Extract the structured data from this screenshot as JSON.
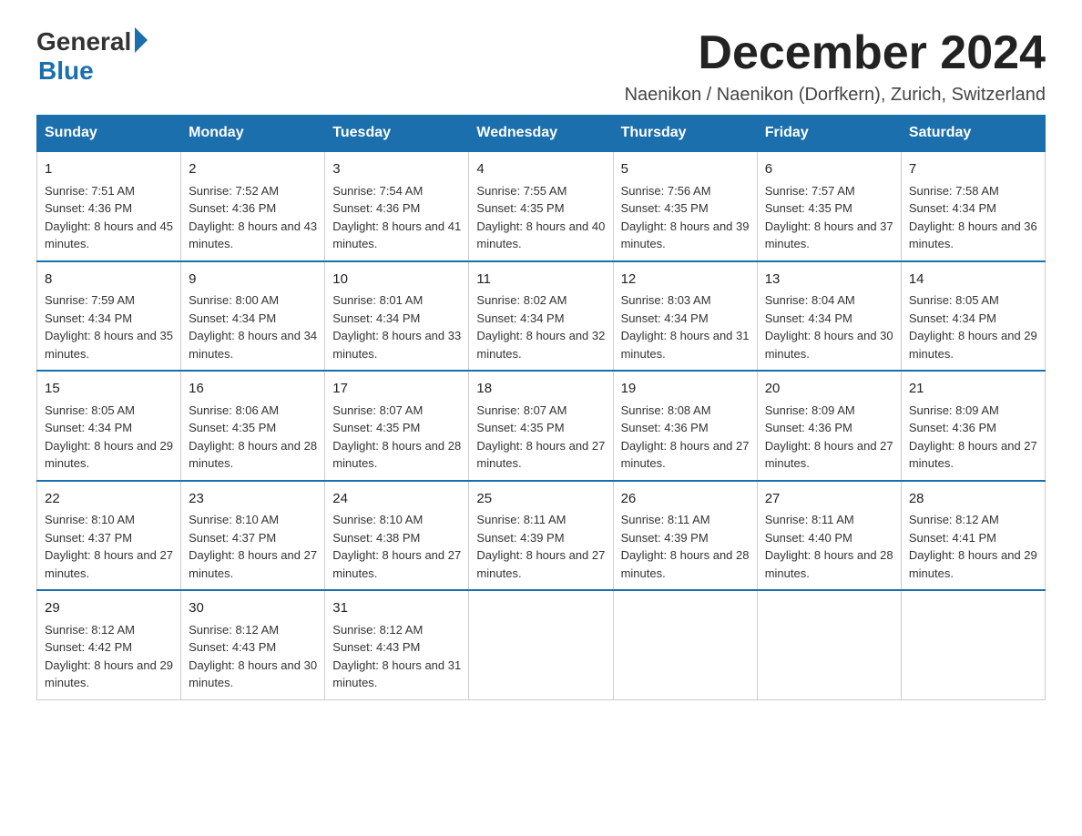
{
  "logo": {
    "general": "General",
    "blue": "Blue"
  },
  "title": "December 2024",
  "subtitle": "Naenikon / Naenikon (Dorfkern), Zurich, Switzerland",
  "days": [
    "Sunday",
    "Monday",
    "Tuesday",
    "Wednesday",
    "Thursday",
    "Friday",
    "Saturday"
  ],
  "weeks": [
    [
      {
        "day": "1",
        "sunrise": "Sunrise: 7:51 AM",
        "sunset": "Sunset: 4:36 PM",
        "daylight": "Daylight: 8 hours and 45 minutes."
      },
      {
        "day": "2",
        "sunrise": "Sunrise: 7:52 AM",
        "sunset": "Sunset: 4:36 PM",
        "daylight": "Daylight: 8 hours and 43 minutes."
      },
      {
        "day": "3",
        "sunrise": "Sunrise: 7:54 AM",
        "sunset": "Sunset: 4:36 PM",
        "daylight": "Daylight: 8 hours and 41 minutes."
      },
      {
        "day": "4",
        "sunrise": "Sunrise: 7:55 AM",
        "sunset": "Sunset: 4:35 PM",
        "daylight": "Daylight: 8 hours and 40 minutes."
      },
      {
        "day": "5",
        "sunrise": "Sunrise: 7:56 AM",
        "sunset": "Sunset: 4:35 PM",
        "daylight": "Daylight: 8 hours and 39 minutes."
      },
      {
        "day": "6",
        "sunrise": "Sunrise: 7:57 AM",
        "sunset": "Sunset: 4:35 PM",
        "daylight": "Daylight: 8 hours and 37 minutes."
      },
      {
        "day": "7",
        "sunrise": "Sunrise: 7:58 AM",
        "sunset": "Sunset: 4:34 PM",
        "daylight": "Daylight: 8 hours and 36 minutes."
      }
    ],
    [
      {
        "day": "8",
        "sunrise": "Sunrise: 7:59 AM",
        "sunset": "Sunset: 4:34 PM",
        "daylight": "Daylight: 8 hours and 35 minutes."
      },
      {
        "day": "9",
        "sunrise": "Sunrise: 8:00 AM",
        "sunset": "Sunset: 4:34 PM",
        "daylight": "Daylight: 8 hours and 34 minutes."
      },
      {
        "day": "10",
        "sunrise": "Sunrise: 8:01 AM",
        "sunset": "Sunset: 4:34 PM",
        "daylight": "Daylight: 8 hours and 33 minutes."
      },
      {
        "day": "11",
        "sunrise": "Sunrise: 8:02 AM",
        "sunset": "Sunset: 4:34 PM",
        "daylight": "Daylight: 8 hours and 32 minutes."
      },
      {
        "day": "12",
        "sunrise": "Sunrise: 8:03 AM",
        "sunset": "Sunset: 4:34 PM",
        "daylight": "Daylight: 8 hours and 31 minutes."
      },
      {
        "day": "13",
        "sunrise": "Sunrise: 8:04 AM",
        "sunset": "Sunset: 4:34 PM",
        "daylight": "Daylight: 8 hours and 30 minutes."
      },
      {
        "day": "14",
        "sunrise": "Sunrise: 8:05 AM",
        "sunset": "Sunset: 4:34 PM",
        "daylight": "Daylight: 8 hours and 29 minutes."
      }
    ],
    [
      {
        "day": "15",
        "sunrise": "Sunrise: 8:05 AM",
        "sunset": "Sunset: 4:34 PM",
        "daylight": "Daylight: 8 hours and 29 minutes."
      },
      {
        "day": "16",
        "sunrise": "Sunrise: 8:06 AM",
        "sunset": "Sunset: 4:35 PM",
        "daylight": "Daylight: 8 hours and 28 minutes."
      },
      {
        "day": "17",
        "sunrise": "Sunrise: 8:07 AM",
        "sunset": "Sunset: 4:35 PM",
        "daylight": "Daylight: 8 hours and 28 minutes."
      },
      {
        "day": "18",
        "sunrise": "Sunrise: 8:07 AM",
        "sunset": "Sunset: 4:35 PM",
        "daylight": "Daylight: 8 hours and 27 minutes."
      },
      {
        "day": "19",
        "sunrise": "Sunrise: 8:08 AM",
        "sunset": "Sunset: 4:36 PM",
        "daylight": "Daylight: 8 hours and 27 minutes."
      },
      {
        "day": "20",
        "sunrise": "Sunrise: 8:09 AM",
        "sunset": "Sunset: 4:36 PM",
        "daylight": "Daylight: 8 hours and 27 minutes."
      },
      {
        "day": "21",
        "sunrise": "Sunrise: 8:09 AM",
        "sunset": "Sunset: 4:36 PM",
        "daylight": "Daylight: 8 hours and 27 minutes."
      }
    ],
    [
      {
        "day": "22",
        "sunrise": "Sunrise: 8:10 AM",
        "sunset": "Sunset: 4:37 PM",
        "daylight": "Daylight: 8 hours and 27 minutes."
      },
      {
        "day": "23",
        "sunrise": "Sunrise: 8:10 AM",
        "sunset": "Sunset: 4:37 PM",
        "daylight": "Daylight: 8 hours and 27 minutes."
      },
      {
        "day": "24",
        "sunrise": "Sunrise: 8:10 AM",
        "sunset": "Sunset: 4:38 PM",
        "daylight": "Daylight: 8 hours and 27 minutes."
      },
      {
        "day": "25",
        "sunrise": "Sunrise: 8:11 AM",
        "sunset": "Sunset: 4:39 PM",
        "daylight": "Daylight: 8 hours and 27 minutes."
      },
      {
        "day": "26",
        "sunrise": "Sunrise: 8:11 AM",
        "sunset": "Sunset: 4:39 PM",
        "daylight": "Daylight: 8 hours and 28 minutes."
      },
      {
        "day": "27",
        "sunrise": "Sunrise: 8:11 AM",
        "sunset": "Sunset: 4:40 PM",
        "daylight": "Daylight: 8 hours and 28 minutes."
      },
      {
        "day": "28",
        "sunrise": "Sunrise: 8:12 AM",
        "sunset": "Sunset: 4:41 PM",
        "daylight": "Daylight: 8 hours and 29 minutes."
      }
    ],
    [
      {
        "day": "29",
        "sunrise": "Sunrise: 8:12 AM",
        "sunset": "Sunset: 4:42 PM",
        "daylight": "Daylight: 8 hours and 29 minutes."
      },
      {
        "day": "30",
        "sunrise": "Sunrise: 8:12 AM",
        "sunset": "Sunset: 4:43 PM",
        "daylight": "Daylight: 8 hours and 30 minutes."
      },
      {
        "day": "31",
        "sunrise": "Sunrise: 8:12 AM",
        "sunset": "Sunset: 4:43 PM",
        "daylight": "Daylight: 8 hours and 31 minutes."
      },
      null,
      null,
      null,
      null
    ]
  ]
}
